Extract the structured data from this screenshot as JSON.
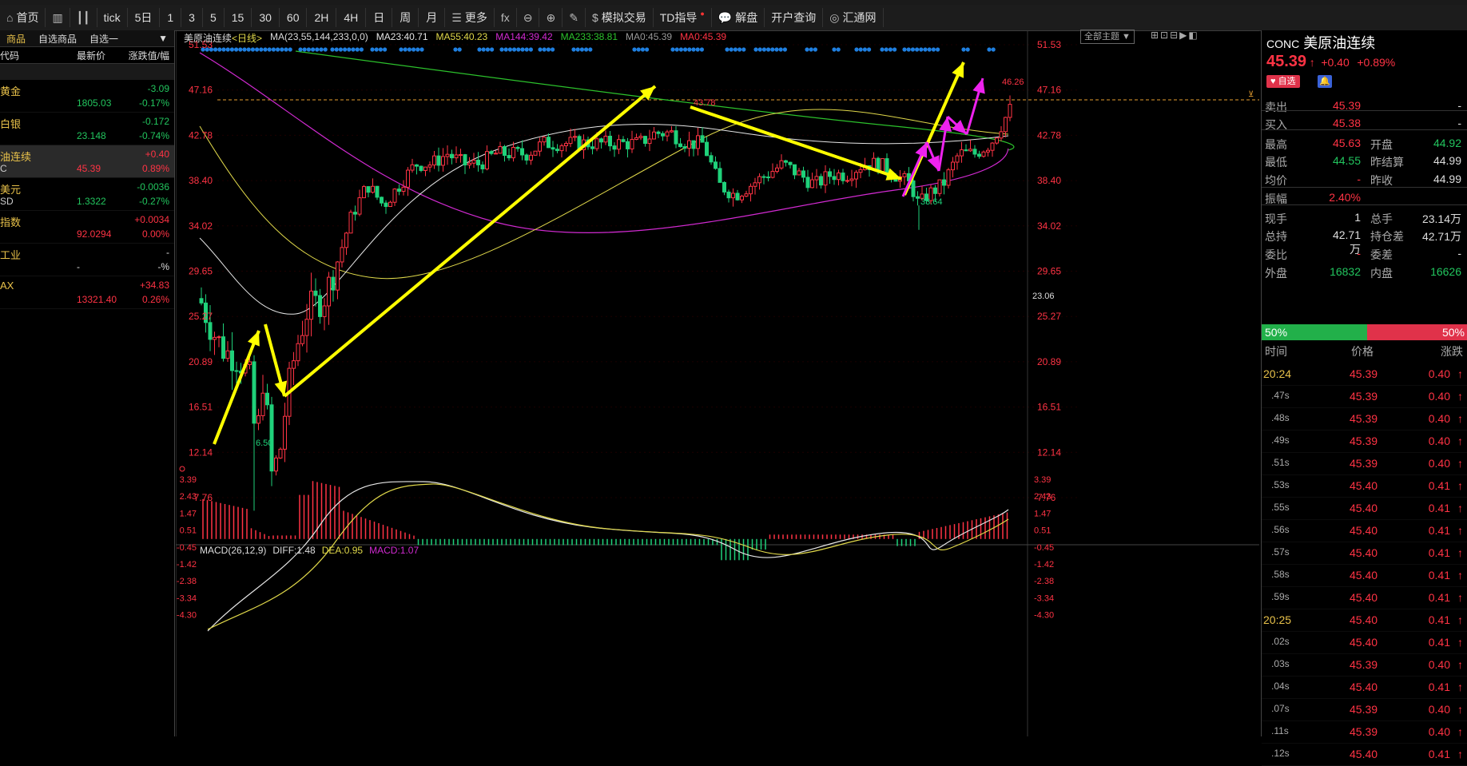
{
  "toolbar": {
    "items": [
      "首页",
      "tick",
      "5日",
      "1",
      "3",
      "5",
      "15",
      "30",
      "60",
      "2H",
      "4H",
      "日",
      "周",
      "月",
      "更多",
      "fx",
      "模拟交易",
      "TD指导",
      "解盘",
      "开户查询",
      "汇通网"
    ]
  },
  "leftpanel": {
    "tabs": [
      "商品",
      "自选商品",
      "自选一"
    ],
    "columns": [
      "代码",
      "最新价",
      "涨跌值/幅"
    ],
    "rows": [
      {
        "name": "黄金",
        "sub": "",
        "price": "1805.03",
        "change": "-3.09",
        "pct": "-0.17%",
        "dir": "down"
      },
      {
        "name": "白银",
        "sub": "",
        "price": "23.148",
        "change": "-0.172",
        "pct": "-0.74%",
        "dir": "down"
      },
      {
        "name": "油连续",
        "sub": "C",
        "price": "45.39",
        "change": "+0.40",
        "pct": "0.89%",
        "dir": "up"
      },
      {
        "name": "美元",
        "sub": "SD",
        "price": "1.3322",
        "change": "-0.0036",
        "pct": "-0.27%",
        "dir": "down"
      },
      {
        "name": "指数",
        "sub": "",
        "price": "92.0294",
        "change": "+0.0034",
        "pct": "0.00%",
        "dir": "up"
      },
      {
        "name": "工业",
        "sub": "",
        "price": "-",
        "change": "-",
        "pct": "-%",
        "dir": "none"
      },
      {
        "name": "AX",
        "sub": "",
        "price": "13321.40",
        "change": "+34.83",
        "pct": "0.26%",
        "dir": "up"
      }
    ]
  },
  "chart": {
    "header": {
      "title": "美原油连续",
      "period": "<日线>",
      "ma_label": "MA(23,55,144,233,0,0)",
      "ma23": "MA23:40.71",
      "ma55": "MA55:40.23",
      "ma144": "MA144:39.42",
      "ma233": "MA233:38.81",
      "ma0a": "MA0:45.39",
      "ma0b": "MA0:45.39",
      "theme_btn": "全部主题"
    },
    "price_axis": [
      "51.53",
      "47.16",
      "42.78",
      "38.40",
      "34.02",
      "29.65",
      "25.27",
      "20.89",
      "16.51",
      "12.14",
      "7.76"
    ],
    "annotations": {
      "low": "6.50",
      "peak": "43.78",
      "dip": "33.64",
      "high": "46.26",
      "last_marker": "23.06"
    },
    "macd": {
      "label": "MACD(26,12,9)",
      "diff": "DIFF:1.48",
      "dea": "DEA:0.95",
      "macd": "MACD:1.07",
      "axis": [
        "3.39",
        "2.43",
        "1.47",
        "0.51",
        "-0.45",
        "-1.42",
        "-2.38",
        "-3.34",
        "-4.30"
      ]
    },
    "colors": {
      "ma23": "#e6e6e6",
      "ma55": "#e0d84a",
      "ma144": "#d12ad1",
      "ma233": "#2cc22c",
      "up": "#ff3344",
      "down": "#1fd17a",
      "arrow_yellow": "#ffff00",
      "arrow_magenta": "#ee22ee"
    }
  },
  "rightpanel": {
    "code": "CONC",
    "name": "美原油连续",
    "price": "45.39",
    "change": "+0.40",
    "pct": "+0.89%",
    "fav": "自选",
    "quotes": [
      {
        "l1": "卖出",
        "v1": "45.39",
        "l2": "",
        "v2": "-"
      },
      {
        "l1": "买入",
        "v1": "45.38",
        "l2": "",
        "v2": "-"
      },
      {
        "l1": "最高",
        "v1": "45.63",
        "l2": "开盘",
        "v2": "44.92"
      },
      {
        "l1": "最低",
        "v1": "44.55",
        "l2": "昨结算",
        "v2": "44.99"
      },
      {
        "l1": "均价",
        "v1": "-",
        "l2": "昨收",
        "v2": "44.99"
      },
      {
        "l1": "振幅",
        "v1": "2.40%",
        "l2": "",
        "v2": ""
      },
      {
        "l1": "现手",
        "v1": "1",
        "l2": "总手",
        "v2": "23.14万"
      },
      {
        "l1": "总持",
        "v1": "42.71万",
        "l2": "持仓差",
        "v2": "42.71万"
      },
      {
        "l1": "委比",
        "v1": "-",
        "l2": "委差",
        "v2": "-"
      },
      {
        "l1": "外盘",
        "v1": "16832",
        "l2": "内盘",
        "v2": "16626"
      }
    ],
    "bar_left": "50%",
    "bar_right": "50%",
    "tick_head": [
      "时间",
      "价格",
      "涨跌"
    ],
    "ticks": [
      {
        "t": "20:24",
        "p": "45.39",
        "c": "0.40"
      },
      {
        "t": ".47s",
        "p": "45.39",
        "c": "0.40"
      },
      {
        "t": ".48s",
        "p": "45.39",
        "c": "0.40"
      },
      {
        "t": ".49s",
        "p": "45.39",
        "c": "0.40"
      },
      {
        "t": ".51s",
        "p": "45.39",
        "c": "0.40"
      },
      {
        "t": ".53s",
        "p": "45.40",
        "c": "0.41"
      },
      {
        "t": ".55s",
        "p": "45.40",
        "c": "0.41"
      },
      {
        "t": ".56s",
        "p": "45.40",
        "c": "0.41"
      },
      {
        "t": ".57s",
        "p": "45.40",
        "c": "0.41"
      },
      {
        "t": ".58s",
        "p": "45.40",
        "c": "0.41"
      },
      {
        "t": ".59s",
        "p": "45.40",
        "c": "0.41"
      },
      {
        "t": "20:25",
        "p": "45.40",
        "c": "0.41"
      },
      {
        "t": ".02s",
        "p": "45.40",
        "c": "0.41"
      },
      {
        "t": ".03s",
        "p": "45.39",
        "c": "0.40"
      },
      {
        "t": ".04s",
        "p": "45.40",
        "c": "0.41"
      },
      {
        "t": ".07s",
        "p": "45.39",
        "c": "0.40"
      },
      {
        "t": ".11s",
        "p": "45.39",
        "c": "0.40"
      },
      {
        "t": ".12s",
        "p": "45.40",
        "c": "0.41"
      }
    ]
  }
}
